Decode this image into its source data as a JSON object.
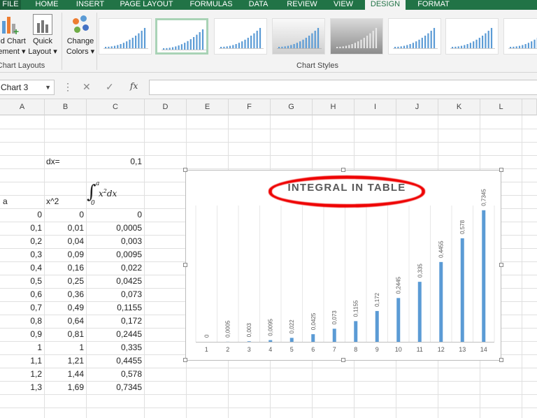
{
  "ribbon_tabs": [
    {
      "label": "FILE"
    },
    {
      "label": "HOME"
    },
    {
      "label": "INSERT"
    },
    {
      "label": "PAGE LAYOUT"
    },
    {
      "label": "FORMULAS"
    },
    {
      "label": "DATA"
    },
    {
      "label": "REVIEW"
    },
    {
      "label": "VIEW"
    },
    {
      "label": "DESIGN",
      "active": true
    },
    {
      "label": "FORMAT"
    }
  ],
  "ribbon": {
    "add_chart_element": {
      "line1": "Add Chart",
      "line2": "Element"
    },
    "quick_layout": {
      "line1": "Quick",
      "line2": "Layout"
    },
    "change_colors": {
      "line1": "Change",
      "line2": "Colors"
    },
    "group_chart_layouts": "Chart Layouts",
    "group_chart_styles": "Chart Styles",
    "style_count": 8,
    "selected_style": 2
  },
  "formula_bar": {
    "name_box": "Chart 3",
    "fx": "fx",
    "formula": ""
  },
  "columns": [
    "A",
    "B",
    "C",
    "D",
    "E",
    "F",
    "G",
    "H",
    "I",
    "J",
    "K",
    "L"
  ],
  "cells": {
    "dx_label": "dx=",
    "dx_value": "0,1",
    "header_a": "a",
    "header_b": "x^2",
    "rows": [
      [
        "0",
        "0",
        "0"
      ],
      [
        "0,1",
        "0,01",
        "0,0005"
      ],
      [
        "0,2",
        "0,04",
        "0,003"
      ],
      [
        "0,3",
        "0,09",
        "0,0095"
      ],
      [
        "0,4",
        "0,16",
        "0,022"
      ],
      [
        "0,5",
        "0,25",
        "0,0425"
      ],
      [
        "0,6",
        "0,36",
        "0,073"
      ],
      [
        "0,7",
        "0,49",
        "0,1155"
      ],
      [
        "0,8",
        "0,64",
        "0,172"
      ],
      [
        "0,9",
        "0,81",
        "0,2445"
      ],
      [
        "1",
        "1",
        "0,335"
      ],
      [
        "1,1",
        "1,21",
        "0,4455"
      ],
      [
        "1,2",
        "1,44",
        "0,578"
      ],
      [
        "1,3",
        "1,69",
        "0,7345"
      ]
    ]
  },
  "chart_data": {
    "type": "bar",
    "title": "INTEGRAL IN TABLE",
    "categories": [
      "1",
      "2",
      "3",
      "4",
      "5",
      "6",
      "7",
      "8",
      "9",
      "10",
      "11",
      "12",
      "13",
      "14"
    ],
    "values": [
      0,
      0.0005,
      0.003,
      0.0095,
      0.022,
      0.0425,
      0.073,
      0.1155,
      0.172,
      0.2445,
      0.335,
      0.4455,
      0.578,
      0.7345
    ],
    "data_labels": [
      "0",
      "0,0005",
      "0,003",
      "0,0095",
      "0,022",
      "0,0425",
      "0,073",
      "0,1155",
      "0,172",
      "0,2445",
      "0,335",
      "0,4455",
      "0,578",
      "0,7345"
    ],
    "ylim": [
      0,
      0.8
    ],
    "bar_color": "#5b9bd5",
    "grid": "vertical",
    "title_highlight_color": "#ee0000"
  }
}
